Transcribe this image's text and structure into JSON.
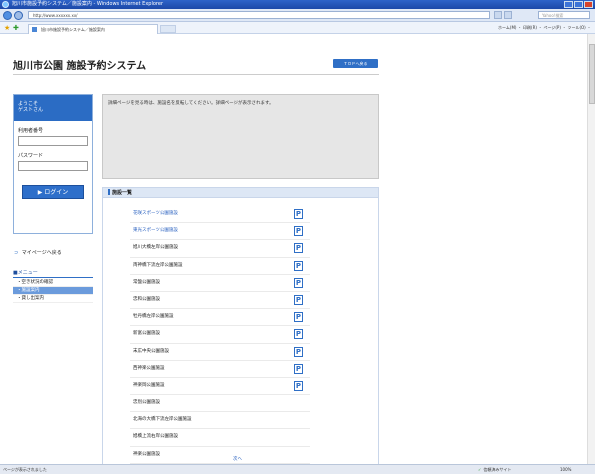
{
  "window": {
    "title": "旭川市施設予約システム／施設案内 - Windows Internet Explorer"
  },
  "browser": {
    "address": "http://www.xxxxxx.xx/",
    "search_placeholder": "Yahoo!検索",
    "tab_title": "旭川市施設予約システム／施設案内",
    "command_bar": "ホーム(M) ・ 印刷(R) ・ ページ(P) ・ ツール(O) ・"
  },
  "page": {
    "title": "旭川市公園 施設予約システム",
    "top_button": "ＴＯＰへ戻る",
    "notice": "詳細ページを見る時は、施設名を反転してください。詳細ページが表示されます。"
  },
  "login": {
    "greeting_line1": "ようこそ",
    "greeting_line2": "ゲストさん",
    "user_id_label": "利用者番号",
    "password_label": "パスワード",
    "button": "▶ ログイン"
  },
  "sidebar": {
    "mypage_link": "マイページへ戻る",
    "menu_head": "■メニュー",
    "menu_items": [
      {
        "label": "・空き状況の確認",
        "active": false
      },
      {
        "label": "・施設案内",
        "active": true
      },
      {
        "label": "・貸し出案内",
        "active": false
      }
    ]
  },
  "facilities": {
    "heading": "施設一覧",
    "items": [
      {
        "name": "花咲スポーツ公園施設",
        "link": true,
        "p": true
      },
      {
        "name": "東光スポーツ公園施設",
        "link": true,
        "p": true
      },
      {
        "name": "旭川大橋左岸公園施設",
        "link": false,
        "p": true
      },
      {
        "name": "両神橋下流左岸公園施設",
        "link": false,
        "p": true
      },
      {
        "name": "常盤公園施設",
        "link": false,
        "p": true
      },
      {
        "name": "忠和公園施設",
        "link": false,
        "p": true
      },
      {
        "name": "牡丹橋左岸公園施設",
        "link": false,
        "p": true
      },
      {
        "name": "新富公園施設",
        "link": false,
        "p": true
      },
      {
        "name": "末広中央公園施設",
        "link": false,
        "p": true
      },
      {
        "name": "西神楽公園施設",
        "link": false,
        "p": true
      },
      {
        "name": "神楽岡公園施設",
        "link": false,
        "p": true
      },
      {
        "name": "忠別公園施設",
        "link": false,
        "p": false
      },
      {
        "name": "北海の大橋下流左岸公園施設",
        "link": false,
        "p": false
      },
      {
        "name": "旭橋上流右岸公園施設",
        "link": false,
        "p": false
      },
      {
        "name": "神楽公園施設",
        "link": false,
        "p": false
      }
    ],
    "p_label": "P",
    "next_link": "次へ"
  },
  "status": {
    "left": "ページが表示されました",
    "zone": "信頼済みサイト",
    "zoom": "100%"
  }
}
